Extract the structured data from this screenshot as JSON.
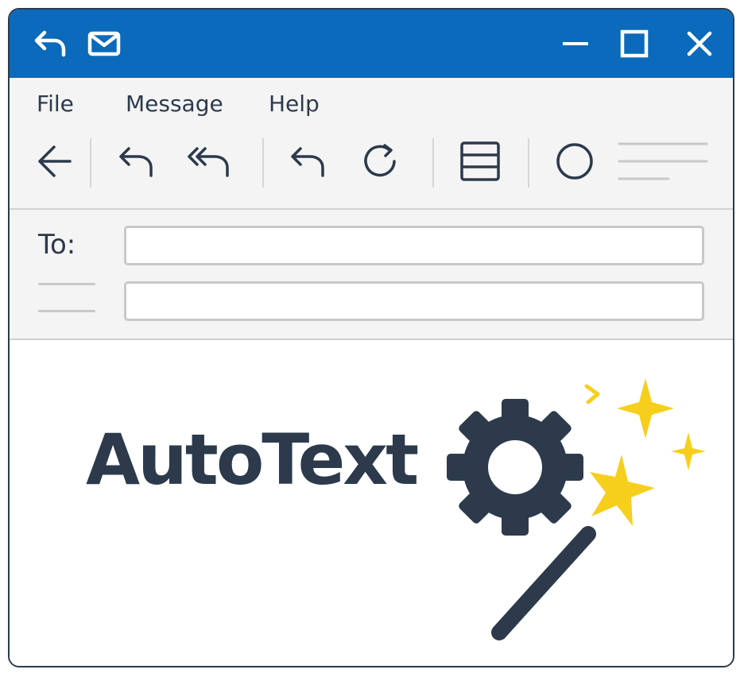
{
  "titlebar": {
    "background": "#0b6abb",
    "icons": [
      "reply-icon",
      "mail-icon",
      "minimize-icon",
      "maximize-icon",
      "close-icon"
    ]
  },
  "menu": {
    "items": [
      "File",
      "Message",
      "Help"
    ]
  },
  "toolbar": {
    "icons": [
      "back-arrow-icon",
      "reply-icon",
      "reply-all-icon",
      "undo-icon",
      "refresh-icon",
      "layout-icon",
      "circle-icon",
      "lines-icon"
    ]
  },
  "header": {
    "to_label": "To:",
    "to_value": "",
    "subject_value": ""
  },
  "logo": {
    "text": "AutoText",
    "text_color": "#2c3a4c",
    "sparkle_color": "#f6cf1c"
  }
}
